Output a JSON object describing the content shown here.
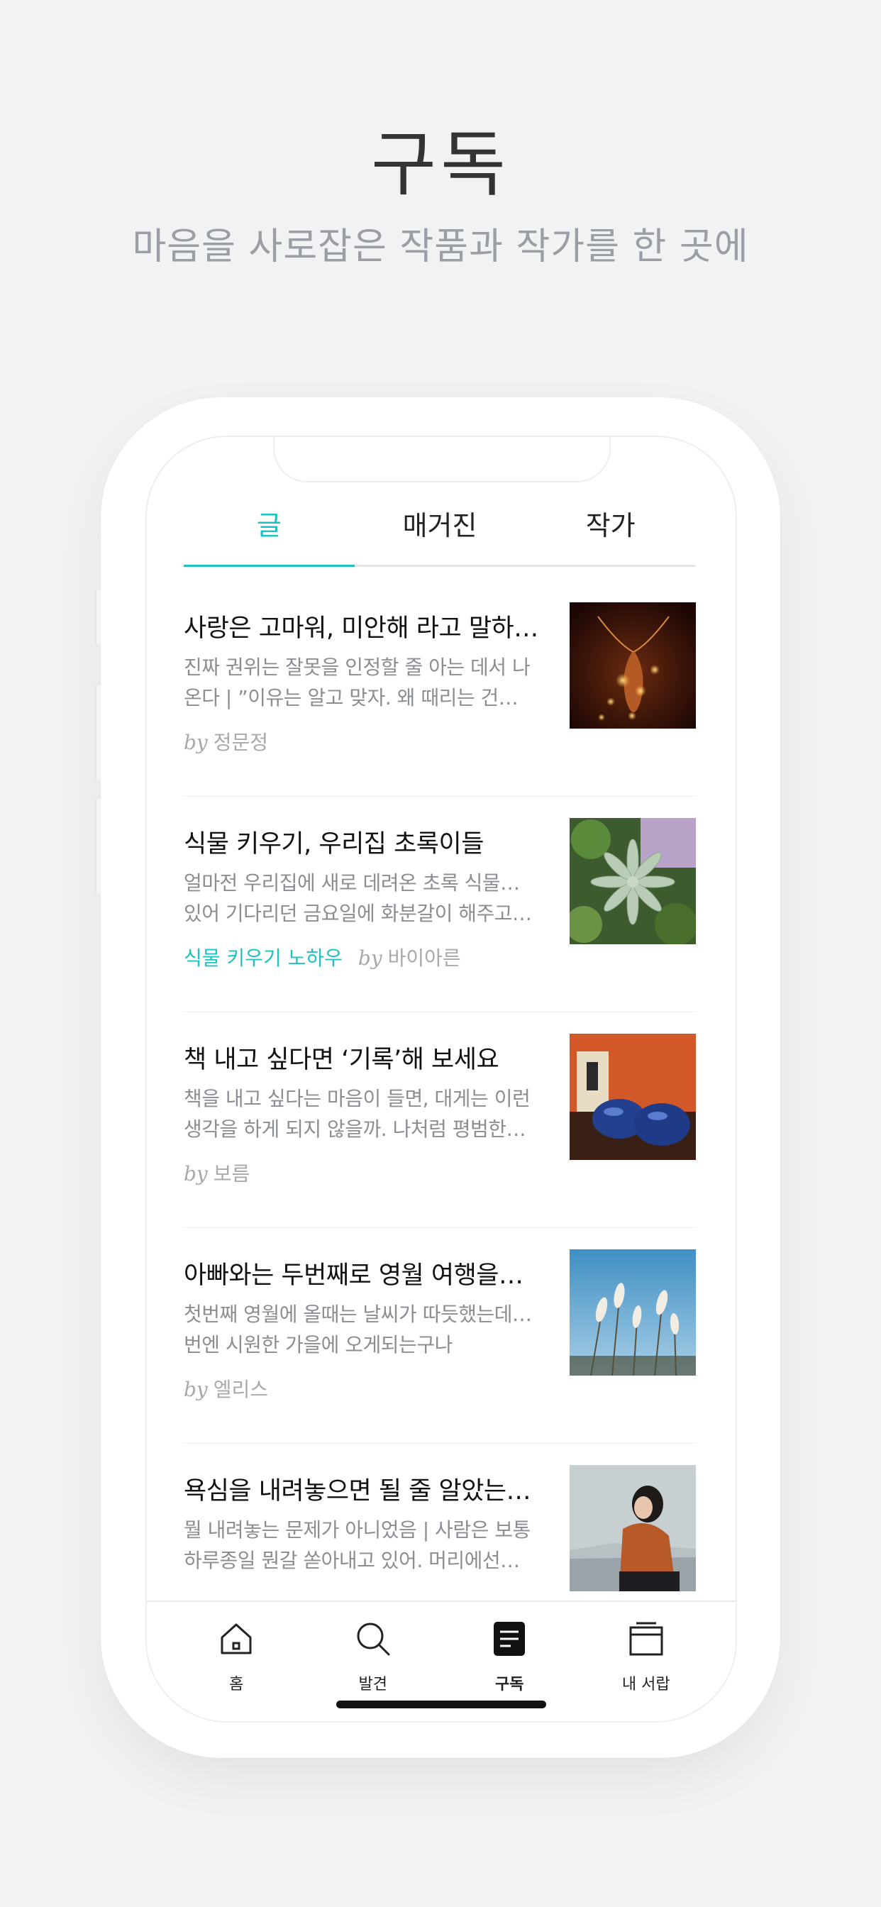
{
  "hero": {
    "title": "구독",
    "subtitle": "마음을 사로잡은 작품과 작가를 한 곳에"
  },
  "tabs": [
    {
      "label": "글",
      "active": true
    },
    {
      "label": "매거진",
      "active": false
    },
    {
      "label": "작가",
      "active": false
    }
  ],
  "articles": [
    {
      "title": "사랑은 고마워, 미안해 라고 말하…",
      "desc_line1": "진짜 권위는 잘못을 인정할 줄 아는 데서 나",
      "desc_line2": "온다 | ”이유는 알고 맞자. 왜 때리는 건데…",
      "magazine": "",
      "by": "by",
      "author": "정문정",
      "thumb": "warm-light-sculpture-photo"
    },
    {
      "title": "식물 키우기, 우리집 초록이들",
      "desc_line1": "얼마전 우리집에 새로 데려온 초록 식물들이",
      "desc_line2": "있어 기다리던 금요일에 화분갈이 해주고…",
      "magazine": "식물 키우기 노하우",
      "by": "by",
      "author": "바이아른",
      "thumb": "succulent-plant-photo"
    },
    {
      "title": "책 내고 싶다면 ‘기록’해 보세요",
      "desc_line1": "책을 내고 싶다는 마음이 들면, 대게는 이런",
      "desc_line2": "생각을 하게 되지 않을까. 나처럼 평범한…",
      "magazine": "",
      "by": "by",
      "author": "보름",
      "thumb": "blue-objects-orange-wall-photo"
    },
    {
      "title": "아빠와는 두번째로 영월 여행을…",
      "desc_line1": "첫번째 영월에 올때는 날씨가 따듯했는데 이",
      "desc_line2": "번엔 시원한 가을에 오게되는구나",
      "magazine": "",
      "by": "by",
      "author": "엘리스",
      "thumb": "pampas-grass-sky-photo"
    },
    {
      "title": "욕심을 내려놓으면 될 줄 알았는…",
      "desc_line1": "뭘 내려놓는 문제가 아니었음 | 사람은 보통",
      "desc_line2": "하루종일 뭔갈 쏟아내고 있어. 머리에선…",
      "magazine": "",
      "by": "",
      "author": "",
      "thumb": "woman-sitting-photo"
    }
  ],
  "bottom_nav": [
    {
      "label": "홈",
      "icon": "home-icon",
      "active": false
    },
    {
      "label": "발견",
      "icon": "search-icon",
      "active": false
    },
    {
      "label": "구독",
      "icon": "subscribe-icon",
      "active": true
    },
    {
      "label": "내 서랍",
      "icon": "drawer-icon",
      "active": false
    }
  ],
  "colors": {
    "accent": "#1bc3c1",
    "background": "#f1f2f4"
  }
}
